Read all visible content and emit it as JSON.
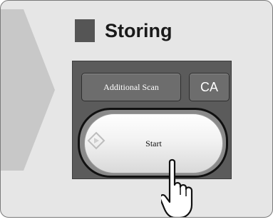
{
  "panel": {
    "title": "Storing",
    "buttons": {
      "additional_scan": "Additional Scan",
      "ca": "CA",
      "start": "Start"
    }
  },
  "colors": {
    "frame_bg": "#e6e6e6",
    "panel_bg": "#5b5b5b",
    "arrow": "#c8c8c8"
  },
  "icons": [
    "arrow-indicator-icon",
    "diamond-start-icon",
    "pointing-hand-icon"
  ]
}
